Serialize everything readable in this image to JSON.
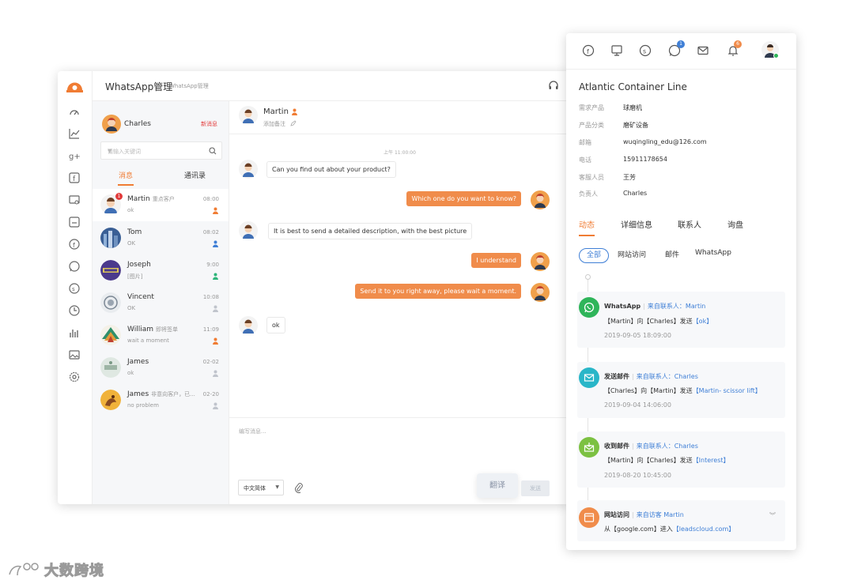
{
  "main": {
    "title": "WhatsApp管理",
    "breadcrumb": "WhatsApp管理",
    "current_user": "Charles",
    "new_message": "新消息",
    "search_placeholder": "请输入关键词",
    "tabs": [
      "消息",
      "通讯录"
    ],
    "conversations": [
      {
        "name": "Martin",
        "tag": "重点客户",
        "preview": "ok",
        "time": "08:00",
        "badge": "1",
        "person_color": "#f07c33"
      },
      {
        "name": "Tom",
        "tag": "",
        "preview": "OK",
        "time": "08:02",
        "person_color": "#3f7fd6"
      },
      {
        "name": "Joseph",
        "tag": "",
        "preview": "[图片]",
        "time": "9:00",
        "person_color": "#2fb57a"
      },
      {
        "name": "Vincent",
        "tag": "",
        "preview": "OK",
        "time": "10:08",
        "person_color": "#c0c4cc"
      },
      {
        "name": "William",
        "tag": "即将签单",
        "preview": "wait a moment",
        "time": "11:09",
        "person_color": "#f07c33"
      },
      {
        "name": "James",
        "tag": "",
        "preview": "ok",
        "time": "02-02",
        "person_color": "#c0c4cc"
      },
      {
        "name": "James",
        "tag": "非意向客户，已...",
        "preview": "no problem",
        "time": "02-20",
        "person_color": "#c0c4cc"
      }
    ]
  },
  "chat": {
    "contact_name": "Martin",
    "add_note": "添加备注",
    "timestamp": "上午 11:00:00",
    "messages": [
      {
        "dir": "in",
        "text": "Can you find out about your product?"
      },
      {
        "dir": "out",
        "text": "Which one do you want to know?"
      },
      {
        "dir": "in",
        "text": "It is best to send a detailed description, with the best picture"
      },
      {
        "dir": "out",
        "text": "I understand"
      },
      {
        "dir": "out",
        "text": "Send it to you right away, please wait a moment."
      },
      {
        "dir": "in",
        "text": "ok"
      }
    ],
    "composer_placeholder": "编写消息...",
    "language": "中文简体",
    "translate": "翻译",
    "send": "发送"
  },
  "panel": {
    "notification_badges": {
      "whatsapp": "1",
      "bell": "6"
    },
    "company": "Atlantic Container Line",
    "fields": [
      {
        "label": "需求产品",
        "value": "球磨机"
      },
      {
        "label": "产品分类",
        "value": "磨矿设备"
      },
      {
        "label": "邮箱",
        "value": "wuqingling_edu@126.com"
      },
      {
        "label": "电话",
        "value": "15911178654"
      },
      {
        "label": "客服人员",
        "value": "王芳"
      },
      {
        "label": "负责人",
        "value": "Charles"
      }
    ],
    "tabs": [
      "动态",
      "详细信息",
      "联系人",
      "询盘"
    ],
    "filters": [
      "全部",
      "网站访问",
      "邮件",
      "WhatsApp"
    ],
    "activities": [
      {
        "type": "WhatsApp",
        "source": "来自联系人：Martin",
        "body_pre": "【Martin】向【Charles】发送",
        "body_hl": "【ok】",
        "date": "2019-09-05 18:09:00",
        "color": "#2fb55a",
        "icon": "whatsapp-icon"
      },
      {
        "type": "发送邮件",
        "source": "来自联系人：Charles",
        "body_pre": "【Charles】向【Martin】发送",
        "body_hl": "【Martin- scissor lift】",
        "date": "2019-09-04 14:06:00",
        "color": "#29b6c8",
        "icon": "mail-send-icon"
      },
      {
        "type": "收到邮件",
        "source": "来自联系人：Charles",
        "body_pre": "【Martin】向【Charles】发送",
        "body_hl": "【Interest】",
        "date": "2019-08-20 10:45:00",
        "color": "#7cc142",
        "icon": "mail-receive-icon"
      },
      {
        "type": "网站访问",
        "source": "来自访客 Martin",
        "body_pre": "从【google.com】进入",
        "body_hl": "【leadscloud.com】",
        "date": "",
        "color": "#f08c4b",
        "icon": "browser-icon"
      }
    ]
  },
  "watermark": "大数跨境"
}
